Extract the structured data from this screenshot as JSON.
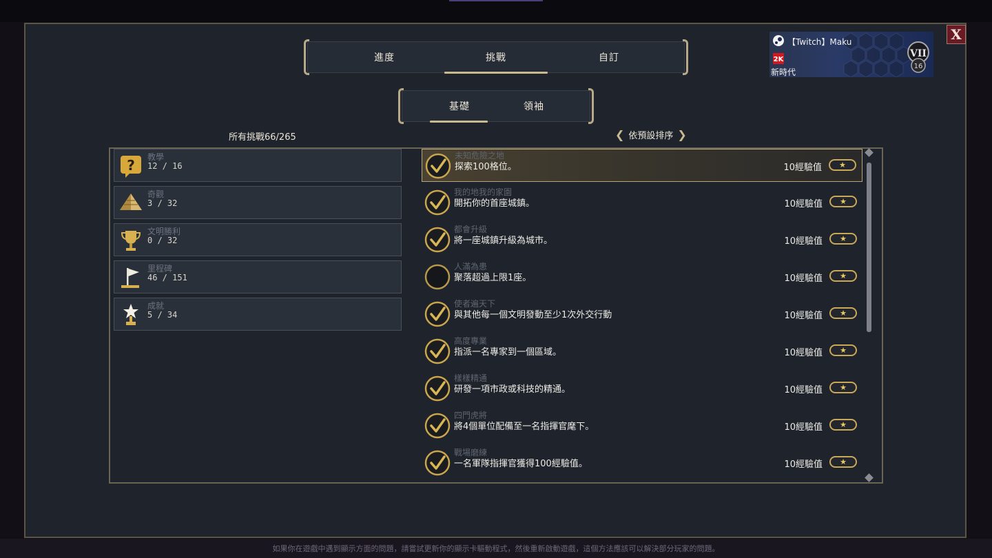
{
  "window": {
    "close_label": "X"
  },
  "main_tabs": [
    {
      "label": "進度",
      "active": false
    },
    {
      "label": "挑戰",
      "active": true
    },
    {
      "label": "自訂",
      "active": false
    }
  ],
  "sub_tabs": [
    {
      "label": "基礎",
      "active": true
    },
    {
      "label": "領袖",
      "active": false
    }
  ],
  "total_challenges_label": "所有挑戰66/265",
  "sort": {
    "label": "依預設排序"
  },
  "profile": {
    "platform_icon": "steam-icon",
    "username": "【Twitch】Maku",
    "publisher_icon": "2k-logo-icon",
    "era": "新時代",
    "rank_numeral": "VII",
    "level": "16",
    "accent_color": "#2a3a66"
  },
  "categories": [
    {
      "name": "教學",
      "count": "12 / 16",
      "icon": "question-icon"
    },
    {
      "name": "奇觀",
      "count": "3 / 32",
      "icon": "pyramid-icon"
    },
    {
      "name": "文明勝利",
      "count": "0 / 32",
      "icon": "trophy-icon"
    },
    {
      "name": "里程碑",
      "count": "46 / 151",
      "icon": "flag-icon"
    },
    {
      "name": "成就",
      "count": "5 / 34",
      "icon": "star-trophy-icon"
    }
  ],
  "challenges": [
    {
      "title": "未知危險之地",
      "desc": "探索100格位。",
      "xp": "10經驗值",
      "completed": true,
      "selected": true
    },
    {
      "title": "我的地我的家園",
      "desc": "開拓你的首座城鎮。",
      "xp": "10經驗值",
      "completed": true
    },
    {
      "title": "都會升級",
      "desc": "將一座城鎮升級為城市。",
      "xp": "10經驗值",
      "completed": true
    },
    {
      "title": "人滿為患",
      "desc": "聚落超過上限1座。",
      "xp": "10經驗值",
      "completed": false
    },
    {
      "title": "使者遍天下",
      "desc": "與其他每一個文明發動至少1次外交行動",
      "xp": "10經驗值",
      "completed": true
    },
    {
      "title": "高度專業",
      "desc": "指派一名專家到一個區域。",
      "xp": "10經驗值",
      "completed": true
    },
    {
      "title": "樣樣精通",
      "desc": "研發一項市政或科技的精通。",
      "xp": "10經驗值",
      "completed": true
    },
    {
      "title": "四門虎將",
      "desc": "將4個單位配備至一名指揮官麾下。",
      "xp": "10經驗值",
      "completed": true
    },
    {
      "title": "戰場磨練",
      "desc": "一名軍隊指揮官獲得100經驗值。",
      "xp": "10經驗值",
      "completed": true
    }
  ],
  "reward_icon": "star-icon",
  "reward_symbol": "★",
  "footer_note": "如果你在遊戲中遇到顯示方面的問題，請嘗試更新你的顯示卡驅動程式，然後重新啟動遊戲，這個方法應該可以解決部分玩家的問題。"
}
